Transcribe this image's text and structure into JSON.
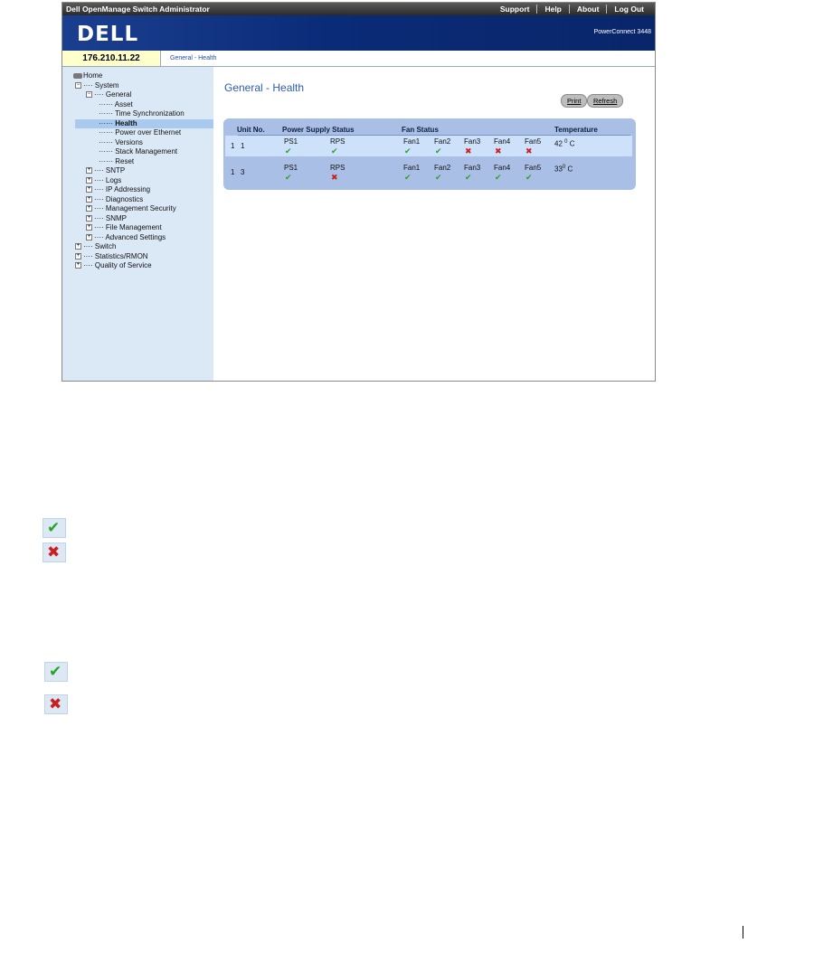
{
  "app_title": "Dell OpenManage Switch Administrator",
  "top_links": [
    "Support",
    "Help",
    "About",
    "Log Out"
  ],
  "brand": "DELL",
  "model": "PowerConnect 3448",
  "ip": "176.210.11.22",
  "breadcrumb": "General - Health",
  "tree": {
    "home": "Home",
    "system": "System",
    "general": "General",
    "general_items": [
      "Asset",
      "Time Synchronization",
      "Health",
      "Power over Ethernet",
      "Versions",
      "Stack Management",
      "Reset"
    ],
    "system_items": [
      "SNTP",
      "Logs",
      "IP Addressing",
      "Diagnostics",
      "Management Security",
      "SNMP",
      "File Management",
      "Advanced Settings"
    ],
    "top_items": [
      "Switch",
      "Statistics/RMON",
      "Quality of Service"
    ]
  },
  "page_title": "General - Health",
  "buttons": {
    "print": "Print",
    "refresh": "Refresh"
  },
  "table": {
    "headers": {
      "unit": "Unit No.",
      "power": "Power Supply Status",
      "fan": "Fan Status",
      "temp": "Temperature"
    },
    "rows": [
      {
        "index": "1",
        "unit": "1",
        "power": [
          {
            "label": "PS1",
            "ok": true
          },
          {
            "label": "RPS",
            "ok": true
          }
        ],
        "fans": [
          {
            "label": "Fan1",
            "ok": true
          },
          {
            "label": "Fan2",
            "ok": true
          },
          {
            "label": "Fan3",
            "ok": false
          },
          {
            "label": "Fan4",
            "ok": false
          },
          {
            "label": "Fan5",
            "ok": false
          }
        ],
        "temp_value": "42",
        "temp_deg": "0",
        "temp_unit": "C"
      },
      {
        "index": "1",
        "unit": "3",
        "power": [
          {
            "label": "PS1",
            "ok": true
          },
          {
            "label": "RPS",
            "ok": false
          }
        ],
        "fans": [
          {
            "label": "Fan1",
            "ok": true
          },
          {
            "label": "Fan2",
            "ok": true
          },
          {
            "label": "Fan3",
            "ok": true
          },
          {
            "label": "Fan4",
            "ok": true
          },
          {
            "label": "Fan5",
            "ok": true
          }
        ],
        "temp_value": "33",
        "temp_deg": "0",
        "temp_unit": "C"
      }
    ]
  },
  "icons": {
    "ok": "green-check-icon",
    "fail": "red-x-icon",
    "ok_color": "#27a327",
    "fail_color": "#cc1f1f"
  }
}
